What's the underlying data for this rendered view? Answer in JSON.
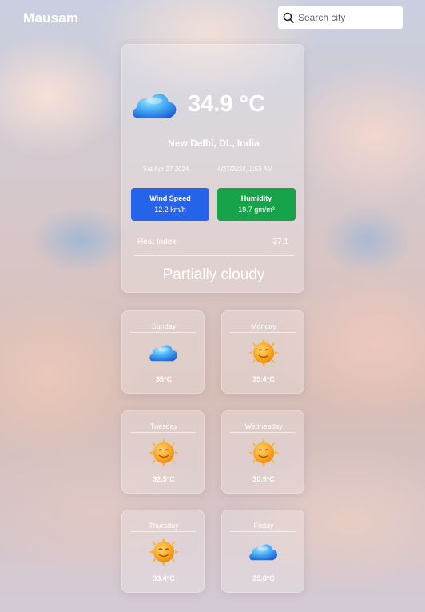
{
  "brand": "Mausam",
  "search": {
    "placeholder": "Search city",
    "icon": "search-icon"
  },
  "current": {
    "temperature": "34.9 °C",
    "location": "New Delhi, DL, India",
    "date": "Sat Apr 27 2024",
    "datetime": "4/27/2024, 2:53 AM",
    "wind_label": "Wind Speed",
    "wind_value": "12.2 km/h",
    "humidity_label": "Humidity",
    "humidity_value": "19.7 gm/m³",
    "heat_index_label": "Heat Index",
    "heat_index_value": "37.1",
    "condition": "Partially cloudy",
    "icon": "cloud-icon"
  },
  "forecast": [
    {
      "day": "Sunday",
      "temp": "35°C",
      "icon": "cloud-icon"
    },
    {
      "day": "Monday",
      "temp": "35.4°C",
      "icon": "sun-icon"
    },
    {
      "day": "Tuesday",
      "temp": "32.5°C",
      "icon": "sun-icon"
    },
    {
      "day": "Wednesday",
      "temp": "30.9°C",
      "icon": "sun-icon"
    },
    {
      "day": "Thursday",
      "temp": "33.4°C",
      "icon": "sun-icon"
    },
    {
      "day": "Friday",
      "temp": "35.8°C",
      "icon": "cloud-icon"
    }
  ],
  "colors": {
    "wind": "#2563eb",
    "humidity": "#16a34a",
    "text": "#ffffff"
  }
}
